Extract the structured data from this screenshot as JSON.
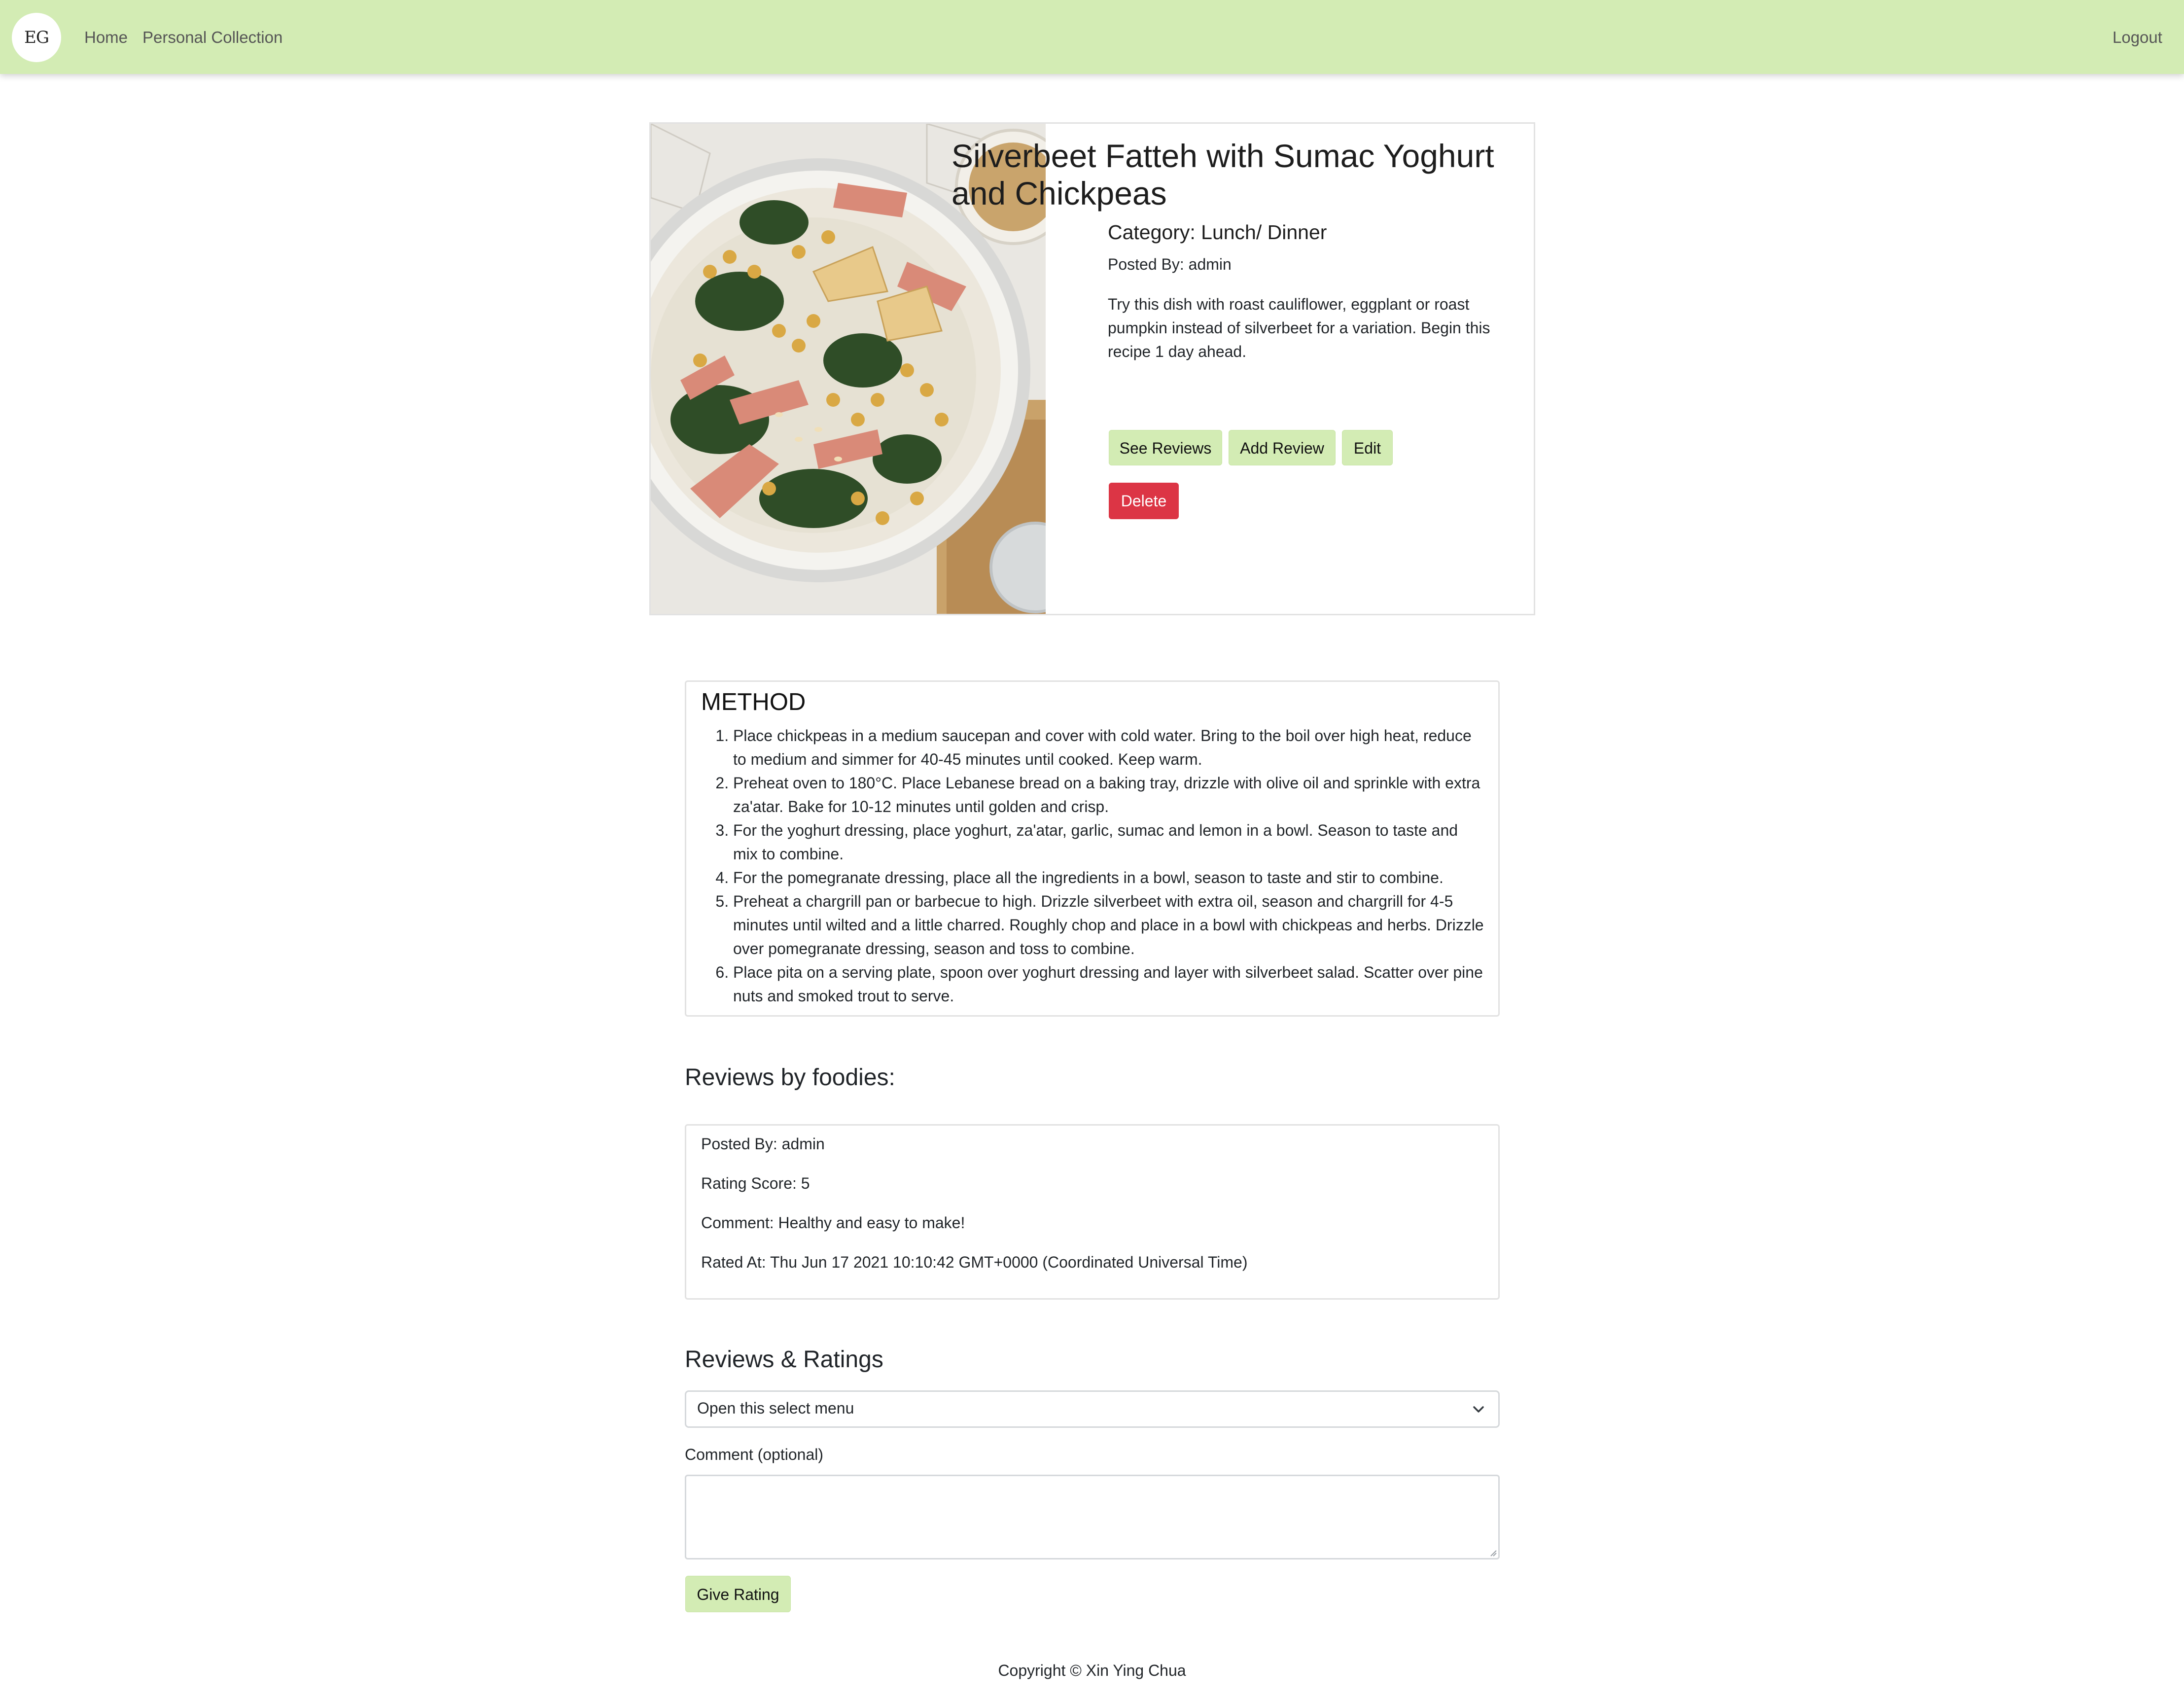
{
  "navbar": {
    "logo_text": "EG",
    "home": "Home",
    "personal_collection": "Personal Collection",
    "logout": "Logout",
    "bg_color": "#d3ecb4"
  },
  "recipe": {
    "title": "Silverbeet Fatteh with Sumac Yoghurt and Chickpeas",
    "category": "Category: Lunch/ Dinner",
    "posted_by": "Posted By: admin",
    "description": "Try this dish with roast cauliflower, eggplant or roast pumpkin instead of silverbeet for a variation. Begin this recipe 1 day ahead.",
    "buttons": {
      "see_reviews": "See Reviews",
      "add_review": "Add Review",
      "edit": "Edit",
      "delete": "Delete"
    },
    "image_icon": "food-photo-icon"
  },
  "method": {
    "title": "METHOD",
    "steps": [
      "Place chickpeas in a medium saucepan and cover with cold water. Bring to the boil over high heat, reduce to medium and simmer for 40-45 minutes until cooked. Keep warm.",
      "Preheat oven to 180°C. Place Lebanese bread on a baking tray, drizzle with olive oil and sprinkle with extra za'atar. Bake for 10-12 minutes until golden and crisp.",
      "For the yoghurt dressing, place yoghurt, za'atar, garlic, sumac and lemon in a bowl. Season to taste and mix to combine.",
      "For the pomegranate dressing, place all the ingredients in a bowl, season to taste and stir to combine.",
      "Preheat a chargrill pan or barbecue to high. Drizzle silverbeet with extra oil, season and chargrill for 4-5 minutes until wilted and a little charred. Roughly chop and place in a bowl with chickpeas and herbs. Drizzle over pomegranate dressing, season and toss to combine.",
      "Place pita on a serving plate, spoon over yoghurt dressing and layer with silverbeet salad. Scatter over pine nuts and smoked trout to serve."
    ]
  },
  "reviews": {
    "heading": "Reviews by foodies:",
    "items": [
      {
        "posted_by": "Posted By: admin",
        "rating": "Rating Score: 5",
        "comment": "Comment: Healthy and easy to make!",
        "rated_at": "Rated At: Thu Jun 17 2021 10:10:42 GMT+0000 (Coordinated Universal Time)"
      }
    ]
  },
  "rating_form": {
    "heading": "Reviews & Ratings",
    "select_value": "Open this select menu",
    "select_icon": "chevron-down-icon",
    "comment_label": "Comment (optional)",
    "comment_value": "",
    "submit": "Give Rating"
  },
  "footer": {
    "copyright": "Copyright © Xin Ying Chua"
  },
  "colors": {
    "accent_green": "#d3ecb4",
    "danger_red": "#dc3545"
  }
}
